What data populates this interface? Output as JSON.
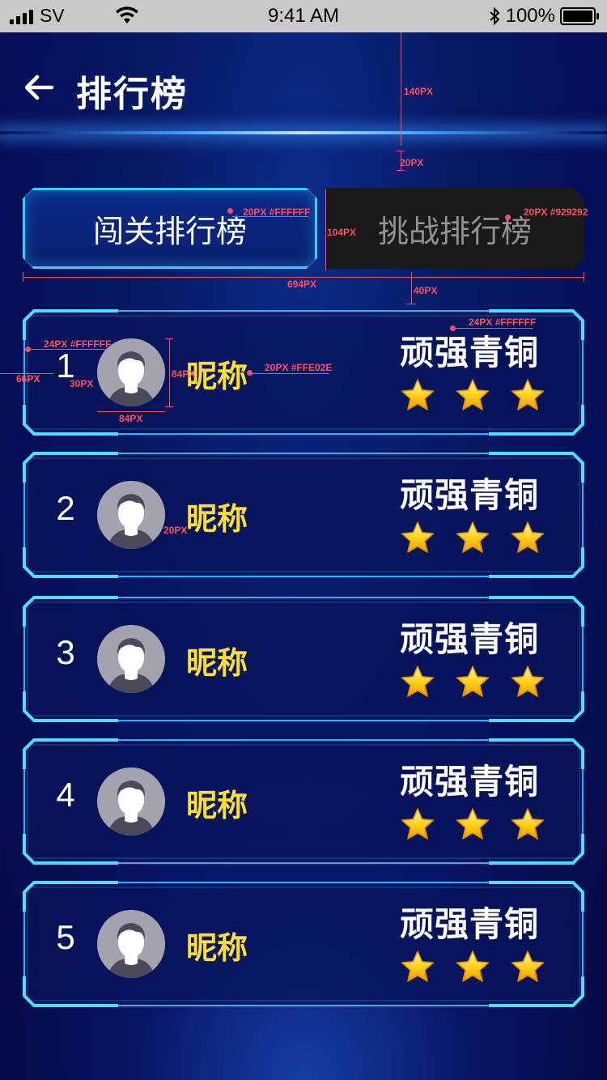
{
  "status_bar": {
    "carrier": "SV",
    "time": "9:41 AM",
    "battery": "100%"
  },
  "header": {
    "title": "排行榜"
  },
  "tabs": [
    {
      "label": "闯关排行榜",
      "active": true
    },
    {
      "label": "挑战排行榜",
      "active": false
    }
  ],
  "annotations": {
    "header_height": "140PX",
    "header_gap": "20PX",
    "tab_active_text": "20PX #FFFFFF",
    "tab_inactive_text": "20PX #929292",
    "tab_height": "104PX",
    "tab_width": "694PX",
    "tab_gap": "40PX",
    "rank_text": "24PX #FFFFFF",
    "left_margin": "66PX",
    "rank_gap": "30PX",
    "avatar_height": "84PX",
    "avatar_width": "84PX",
    "nickname_text": "20PX #FFE02E",
    "title_text": "24PX #FFFFFF",
    "nickname_gap": "20PX"
  },
  "ranking": [
    {
      "rank": "1",
      "nickname": "昵称",
      "title": "顽强青铜",
      "stars": 3
    },
    {
      "rank": "2",
      "nickname": "昵称",
      "title": "顽强青铜",
      "stars": 3
    },
    {
      "rank": "3",
      "nickname": "昵称",
      "title": "顽强青铜",
      "stars": 3
    },
    {
      "rank": "4",
      "nickname": "昵称",
      "title": "顽强青铜",
      "stars": 3
    },
    {
      "rank": "5",
      "nickname": "昵称",
      "title": "顽强青铜",
      "stars": 3
    }
  ],
  "colors": {
    "accent_cyan": "#2ad4ff",
    "nickname_yellow": "#FFE02E",
    "inactive_gray": "#929292",
    "annotation_red": "#ff4d5e"
  }
}
